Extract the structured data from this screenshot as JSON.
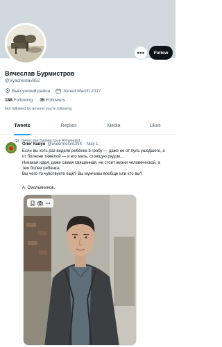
{
  "profile": {
    "display_name": "Вячеслав Бурмистров",
    "handle": "@Vyacheslav852",
    "location": "Выксунский район",
    "joined": "Joined March 2017",
    "following_count": "188",
    "following_label": "Following",
    "followers_count": "35",
    "followers_label": "Followers",
    "not_followed": "Not followed by anyone you're following"
  },
  "actions": {
    "more_label": "•••",
    "follow_label": "Follow"
  },
  "tabs": [
    {
      "label": "Tweets",
      "active": true
    },
    {
      "label": "Replies",
      "active": false
    },
    {
      "label": "Media",
      "active": false
    },
    {
      "label": "Likes",
      "active": false
    }
  ],
  "tweet": {
    "retweet_by": "Вячеслав Бурмистров Retweeted",
    "author_name": "Олег Кавун",
    "author_handle": "@watermelonONK",
    "date": "· May 1",
    "lines": [
      "Если вы хоть раз видели ребёнка в гробу — даже не от пуль ушедшего, а",
      "от болезни тяжёлой — и его мать, стоящую рядом…",
      "Никакая идея, даже самая священная, не стоит жизни человеческой, а",
      "тем более ребёнка.",
      "Вы чего-то чувствуете ещё? Вы мужчины вообще или кто вы?"
    ],
    "signature": "А. Смольянинов."
  },
  "colors": {
    "accent": "#1d9bf0",
    "text_primary": "#0f1419",
    "text_secondary": "#536471",
    "banner": "#cfd9de"
  }
}
